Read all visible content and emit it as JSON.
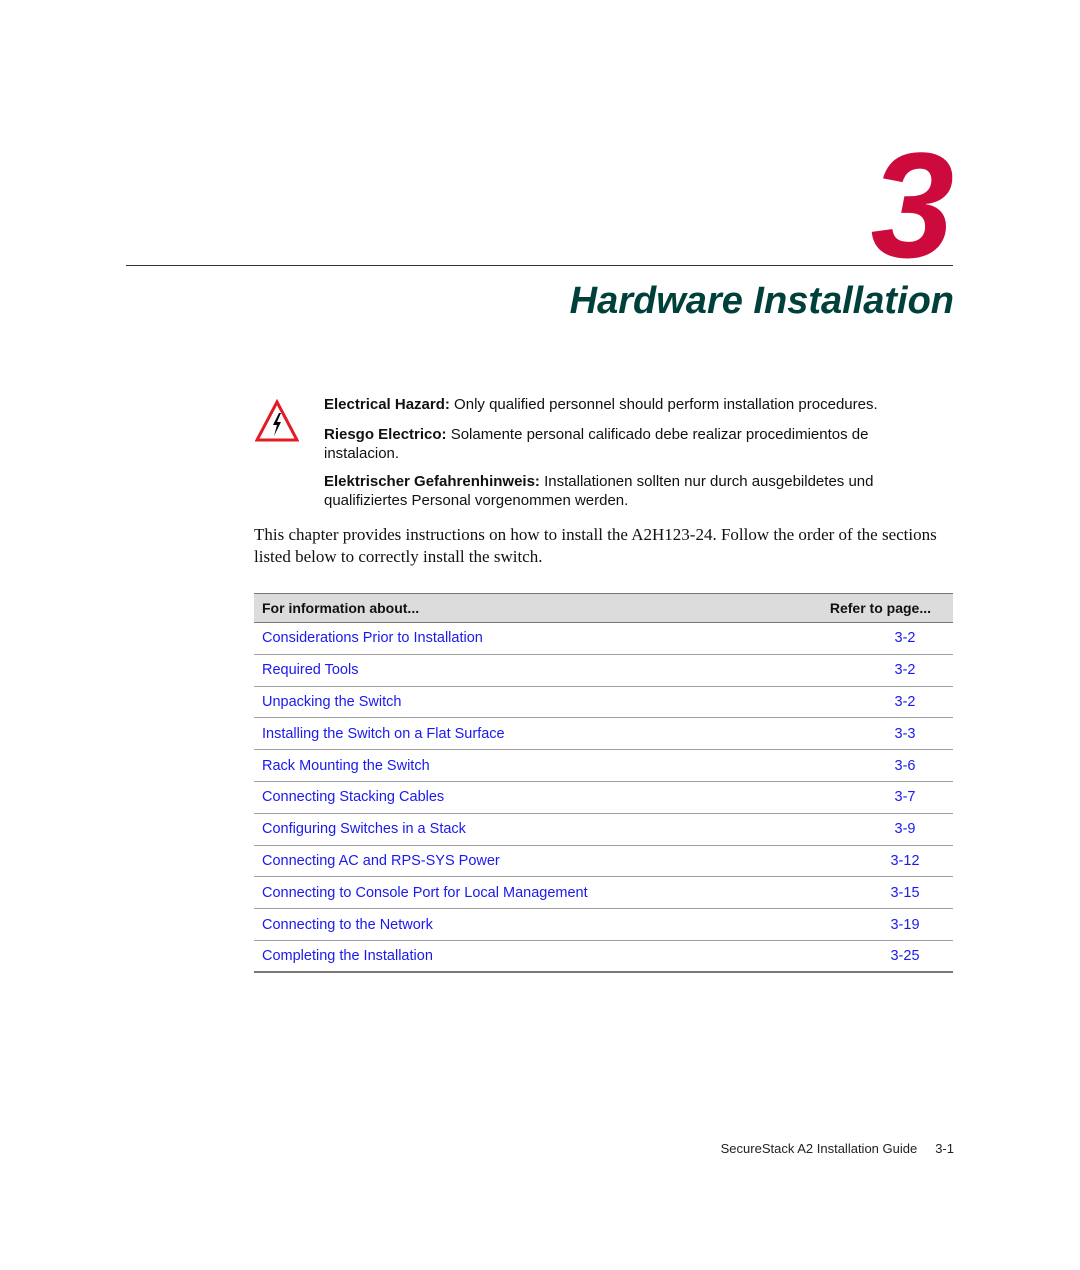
{
  "chapter": {
    "number": "3",
    "title": "Hardware Installation",
    "accent_color": "#cc0a3c",
    "title_color": "#00403b"
  },
  "warnings": {
    "icon": "electrical-hazard-icon",
    "items": [
      {
        "label": "Electrical Hazard:",
        "text": " Only qualified personnel should perform installation procedures."
      },
      {
        "label": "Riesgo Electrico:",
        "text": " Solamente personal calificado debe realizar procedimientos de instalacion."
      },
      {
        "label": "Elektrischer Gefahrenhinweis:",
        "text": " Installationen sollten nur durch ausgebildetes und qualifiziertes Personal vorgenommen werden."
      }
    ]
  },
  "intro": "This chapter provides instructions on how to install the A2H123-24. Follow the order of the sections listed below to correctly install the switch.",
  "toc": {
    "header": {
      "topic": "For information about...",
      "page": "Refer to page..."
    },
    "rows": [
      {
        "topic": "Considerations Prior to Installation",
        "page": "3-2"
      },
      {
        "topic": "Required Tools",
        "page": "3-2"
      },
      {
        "topic": "Unpacking the Switch",
        "page": "3-2"
      },
      {
        "topic": "Installing the Switch on a Flat Surface",
        "page": "3-3"
      },
      {
        "topic": "Rack Mounting the Switch",
        "page": "3-6"
      },
      {
        "topic": "Connecting Stacking Cables",
        "page": "3-7"
      },
      {
        "topic": "Configuring Switches in a Stack",
        "page": "3-9"
      },
      {
        "topic": "Connecting AC and RPS-SYS Power",
        "page": "3-12"
      },
      {
        "topic": "Connecting to Console Port for Local Management",
        "page": "3-15"
      },
      {
        "topic": "Connecting to the Network",
        "page": "3-19"
      },
      {
        "topic": "Completing the Installation",
        "page": "3-25"
      }
    ]
  },
  "footer": {
    "guide_title": "SecureStack A2 Installation Guide",
    "page_number": "3-1"
  }
}
